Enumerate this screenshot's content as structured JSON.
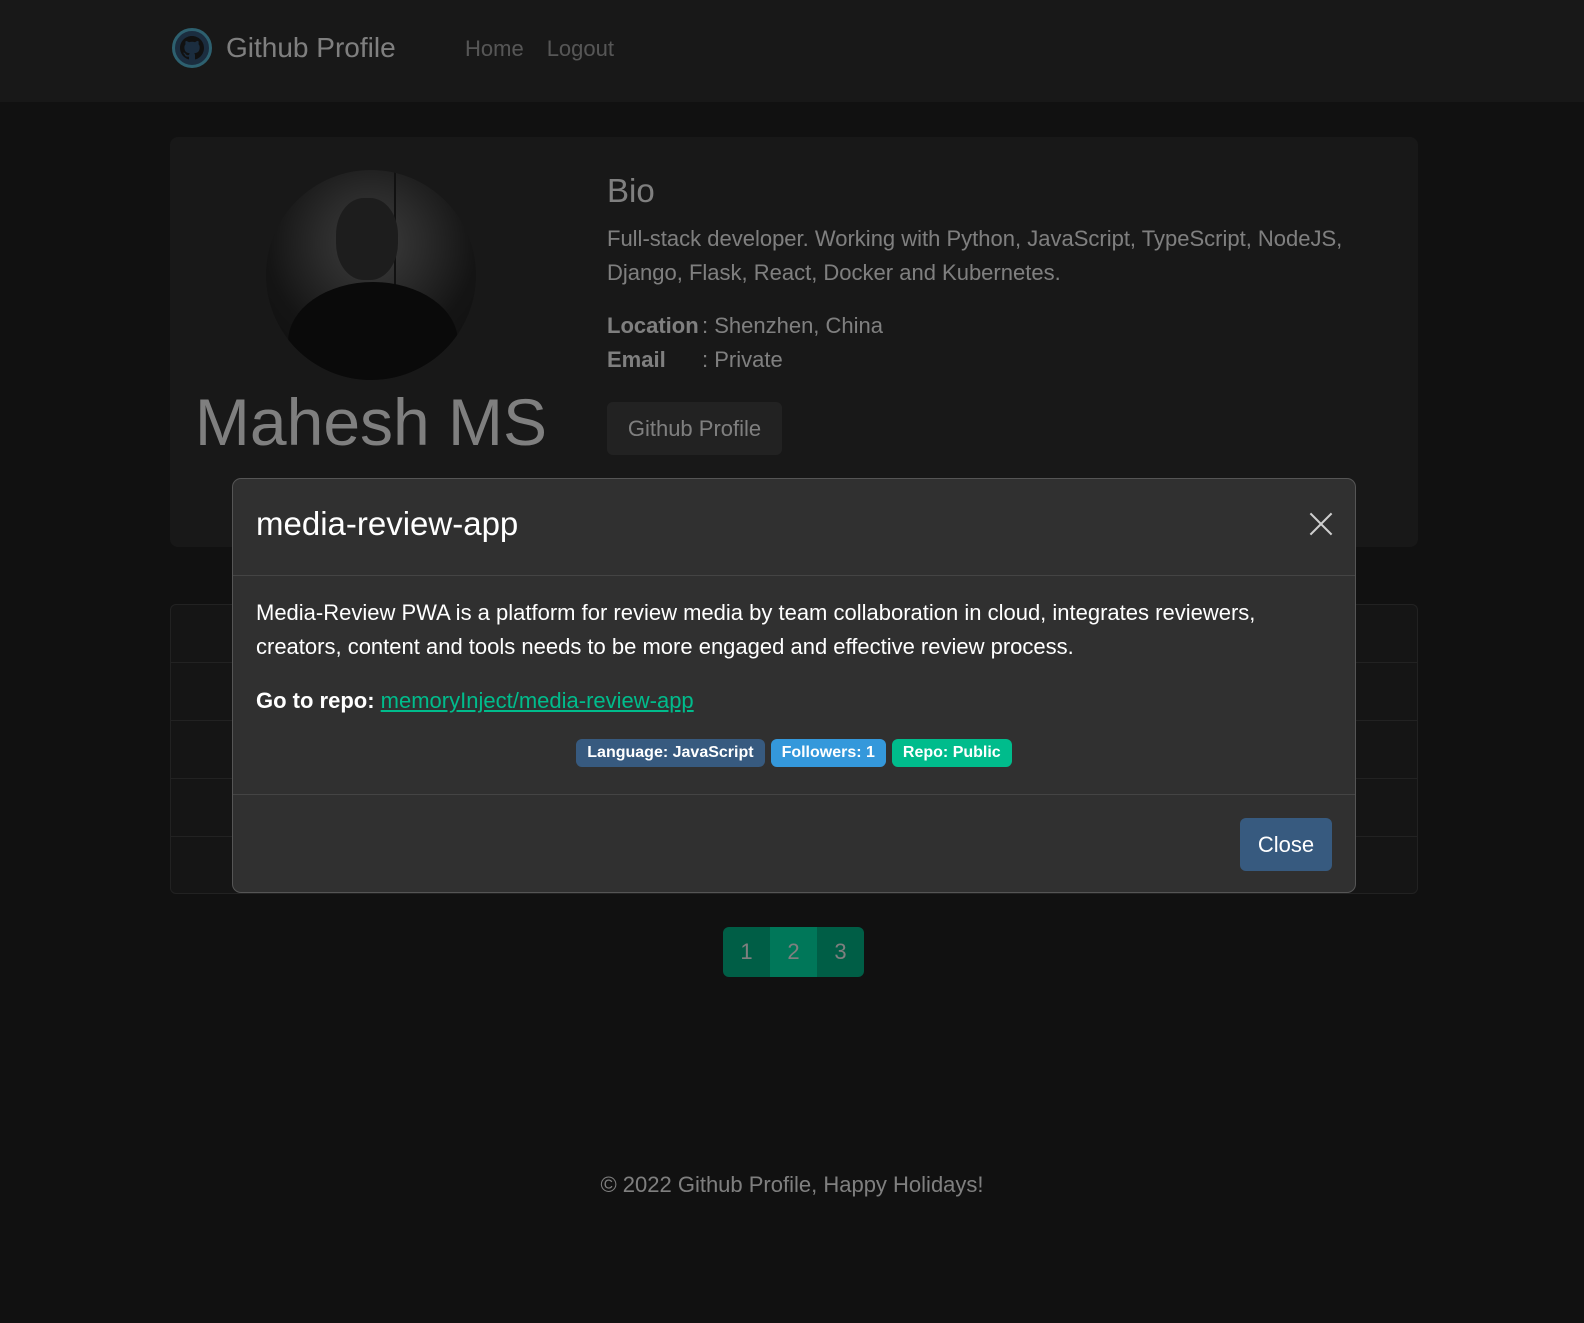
{
  "navbar": {
    "brand": "Github Profile",
    "links": [
      "Home",
      "Logout"
    ]
  },
  "profile": {
    "name": "Mahesh MS",
    "bio_title": "Bio",
    "bio": "Full-stack developer. Working with Python, JavaScript, TypeScript, NodeJS, Django, Flask, React, Docker and Kubernetes.",
    "location_label": "Location",
    "location_value": ": Shenzhen, China",
    "email_label": "Email",
    "email_value": ": Private",
    "github_button": "Github Profile"
  },
  "pagination": {
    "pages": [
      "1",
      "2",
      "3"
    ],
    "active": "2"
  },
  "footer": "© 2022 Github Profile, Happy Holidays!",
  "modal": {
    "title": "media-review-app",
    "description": "Media-Review PWA is a platform for review media by team collaboration in cloud, integrates reviewers, creators, content and tools needs to be more engaged and effective review process.",
    "repo_label": "Go to repo:",
    "repo_link": "memoryInject/media-review-app",
    "badges": {
      "language": "Language: JavaScript",
      "followers": "Followers: 1",
      "repo": "Repo: Public"
    },
    "close_label": "Close"
  },
  "colors": {
    "primary": "#375a7f",
    "success": "#00bc8c",
    "info": "#3498db",
    "background": "#222222"
  }
}
